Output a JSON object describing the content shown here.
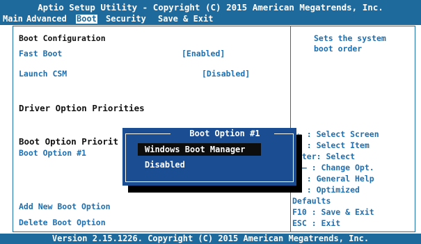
{
  "header": {
    "title": "Aptio Setup Utility - Copyright (C) 2015 American Megatrends, Inc.",
    "menu": [
      "Main",
      "Advanced",
      "Boot",
      "Security",
      "Save & Exit"
    ]
  },
  "left": {
    "boot_configuration": "Boot Configuration",
    "fast_boot_label": "Fast Boot",
    "fast_boot_value": "[Enabled]",
    "launch_csm_label": "Launch CSM",
    "launch_csm_value": "[Disabled]",
    "driver_option_priorities": "Driver Option Priorities",
    "boot_option_priorities": "Boot Option Priorit",
    "boot_option_1_label": "Boot Option #1",
    "add_new_boot_option": "Add New Boot Option",
    "delete_boot_option": "Delete Boot Option"
  },
  "help": {
    "desc_line1": "Sets the system",
    "desc_line2": "boot order",
    "keys": [
      "→←  : Select Screen",
      "↑↓   : Select Item",
      "Enter: Select",
      "+/—  : Change Opt.",
      "F1   : General Help",
      "F9   : Optimized",
      "Defaults",
      "F10  : Save & Exit",
      "ESC  : Exit"
    ]
  },
  "popup": {
    "title": "Boot Option #1",
    "options": [
      "Windows Boot Manager",
      "Disabled"
    ],
    "selected": "Windows Boot Manager"
  },
  "footer": {
    "version": "Version 2.15.1226. Copyright (C) 2015 American Megatrends, Inc."
  },
  "colors": {
    "header_bg": "#1f6a9c",
    "popup_bg": "#1b4d93",
    "link_text": "#1f6fb0",
    "highlight_bg": "#0d0d0d"
  }
}
